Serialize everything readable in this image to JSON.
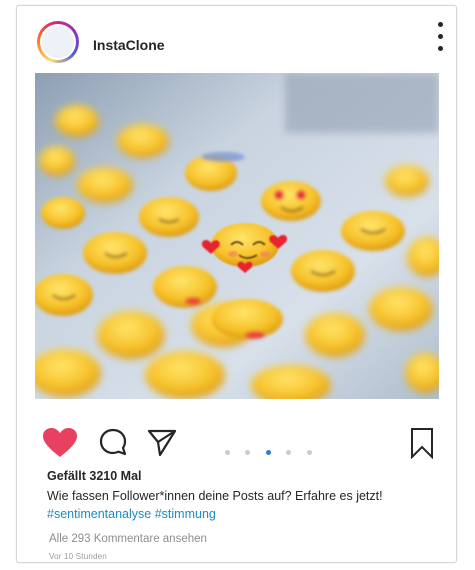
{
  "post": {
    "username": "InstaClone",
    "likes_text": "Gefällt 3210 Mal",
    "caption": "Wie fassen Follower*innen deine Posts auf? Erfahre es jetzt!",
    "hashtags": [
      "#sentimentanalyse",
      "#stimmung"
    ],
    "comments_link": "Alle 293 Kommentare ansehen",
    "timestamp": "Vor 10 Stunden",
    "liked": true,
    "carousel": {
      "count": 5,
      "active_index": 2
    }
  },
  "icons": {
    "like": "heart-icon",
    "comment": "speech-bubble-icon",
    "share": "paper-plane-icon",
    "save": "bookmark-icon",
    "more": "vertical-dots-icon"
  },
  "colors": {
    "heart": "#e8415f",
    "hashtag": "#1d8bbf",
    "active_dot": "#2c7be5",
    "inactive_dot": "#c7ccd6"
  }
}
